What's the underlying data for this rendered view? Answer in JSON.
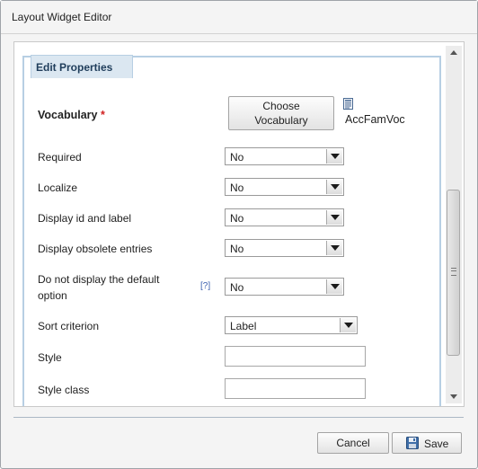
{
  "window": {
    "title": "Layout Widget Editor"
  },
  "panel": {
    "tab_label": "Edit Properties"
  },
  "vocabulary": {
    "label": "Vocabulary",
    "required_mark": "*",
    "button_line1": "Choose",
    "button_line2": "Vocabulary",
    "selected_value": "AccFamVoc"
  },
  "fields": {
    "required": {
      "label": "Required",
      "value": "No"
    },
    "localize": {
      "label": "Localize",
      "value": "No"
    },
    "display_id_label": {
      "label": "Display id and label",
      "value": "No"
    },
    "display_obsolete": {
      "label": "Display obsolete entries",
      "value": "No"
    },
    "no_default_option": {
      "label_line1": "Do not display the default",
      "label_line2": "option",
      "help": "[?]",
      "value": "No"
    },
    "sort_criterion": {
      "label": "Sort criterion",
      "value": "Label"
    },
    "style": {
      "label": "Style",
      "value": ""
    },
    "style_class": {
      "label": "Style class",
      "value": ""
    }
  },
  "footer": {
    "cancel_label": "Cancel",
    "save_label": "Save"
  },
  "icons": {
    "vocabulary": "document-icon",
    "save": "floppy-disk-icon",
    "scroll_up": "arrow-up-icon",
    "scroll_down": "arrow-down-icon"
  },
  "colors": {
    "panel_border": "#b7cfe3",
    "tab_background": "#dbe7f1",
    "required_star": "#d02020",
    "help_link": "#3a5fae"
  }
}
